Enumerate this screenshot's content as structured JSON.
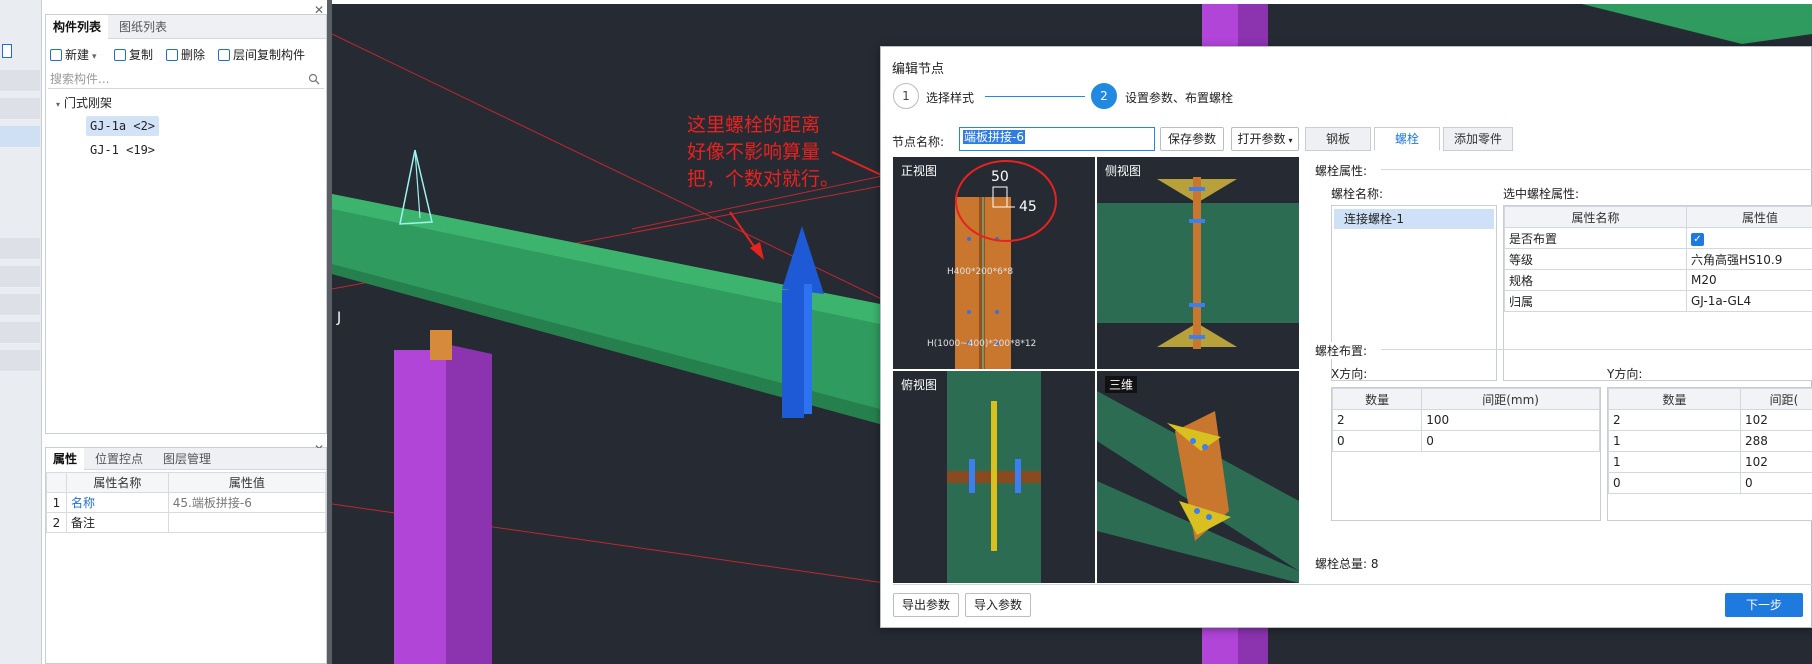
{
  "component_panel": {
    "tabs": [
      "构件列表",
      "图纸列表"
    ],
    "toolbar": {
      "new": "新建",
      "copy": "复制",
      "delete": "删除",
      "floor_copy": "层间复制构件"
    },
    "search_placeholder": "搜索构件...",
    "tree": {
      "root": "门式刚架",
      "items": [
        "GJ-1a <2>",
        "GJ-1 <19>"
      ]
    }
  },
  "properties_panel": {
    "tabs": [
      "属性",
      "位置控点",
      "图层管理"
    ],
    "columns": [
      "属性名称",
      "属性值"
    ],
    "rows": [
      {
        "index": "1",
        "name": "名称",
        "value": "45.端板拼接-6"
      },
      {
        "index": "2",
        "name": "备注",
        "value": ""
      }
    ]
  },
  "viewport": {
    "annotation": [
      "这里螺栓的距离",
      "好像不影响算量",
      "把，个数对就行。"
    ],
    "axis_label": "J"
  },
  "dialog": {
    "title": "编辑节点",
    "steps": [
      {
        "number": "1",
        "label": "选择样式"
      },
      {
        "number": "2",
        "label": "设置参数、布置螺栓"
      }
    ],
    "node_name_label": "节点名称:",
    "node_name_value": "端板拼接-6",
    "save_params": "保存参数",
    "open_params": "打开参数",
    "tabs": [
      "钢板",
      "螺栓",
      "添加零件"
    ],
    "views": {
      "front": "正视图",
      "side": "侧视图",
      "top": "俯视图",
      "three_d": "三维"
    },
    "front_view_labels": {
      "beam1": "H400*200*6*8",
      "beam2": "H(1000~400)*200*8*12",
      "dim_top": "50",
      "dim_right": "45"
    },
    "bolt_props": {
      "section": "螺栓属性:",
      "name_label": "螺栓名称:",
      "names": [
        "连接螺栓-1"
      ],
      "selected_label": "选中螺栓属性:",
      "columns": [
        "属性名称",
        "属性值"
      ],
      "rows": [
        {
          "name": "是否布置",
          "value": "✓"
        },
        {
          "name": "等级",
          "value": "六角高强HS10.9"
        },
        {
          "name": "规格",
          "value": "M20"
        },
        {
          "name": "归属",
          "value": "GJ-1a-GL4"
        }
      ]
    },
    "bolt_layout": {
      "section": "螺栓布置:",
      "x_label": "X方向:",
      "y_label": "Y方向:",
      "x_columns": [
        "数量",
        "间距(mm)"
      ],
      "x_rows": [
        [
          "2",
          "100"
        ],
        [
          "0",
          "0"
        ]
      ],
      "y_columns": [
        "数量",
        "间距("
      ],
      "y_rows": [
        [
          "2",
          "102"
        ],
        [
          "1",
          "288"
        ],
        [
          "1",
          "102"
        ],
        [
          "0",
          "0"
        ]
      ]
    },
    "total_label": "螺栓总量:",
    "total_value": "8",
    "export_params": "导出参数",
    "import_params": "导入参数",
    "next": "下一步"
  }
}
